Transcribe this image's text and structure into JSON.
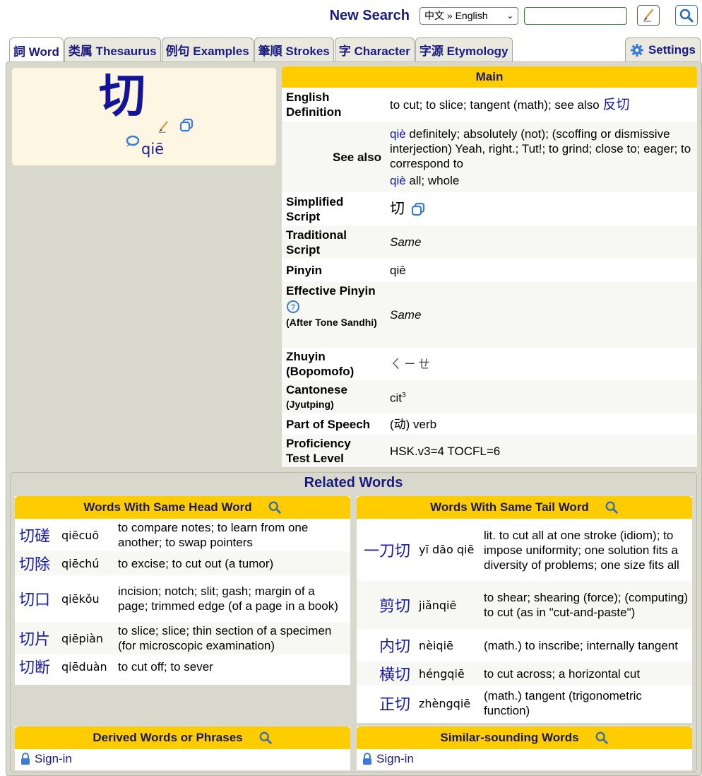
{
  "header": {
    "new_search_label": "New Search",
    "language_select": "中文 » English",
    "search_input_value": "",
    "handwriting_icon": "brush-icon",
    "search_icon": "search-icon"
  },
  "tabs": [
    {
      "label": "詞 Word",
      "active": true
    },
    {
      "label": "类属 Thesaurus"
    },
    {
      "label": "例句 Examples"
    },
    {
      "label": "筆順 Strokes"
    },
    {
      "label": "字 Character"
    },
    {
      "label": "字源 Etymology"
    }
  ],
  "settings_tab": {
    "label": "Settings",
    "icon": "gear-icon"
  },
  "colors": {
    "accent_yellow": "#ffcc00",
    "link_blue": "#1a1aa8",
    "title_navy": "#1a1a80",
    "panel_bg": "#d8d8cd",
    "card_bg": "#fcf6e2"
  },
  "word_card": {
    "character": "切",
    "pinyin": "qiē"
  },
  "main": {
    "title": "Main",
    "english_definition_label": "English Definition",
    "english_definition_text": "to cut; to slice; tangent (math); see also",
    "english_definition_link": "反切",
    "see_also_label": "See also",
    "see_also": [
      {
        "pinyin": "qiè",
        "text": "definitely; absolutely (not); (scoffing or dismissive interjection) Yeah, right.; Tut!; to grind; close to; eager; to correspond to"
      },
      {
        "pinyin": "qiè",
        "text": "all; whole"
      }
    ],
    "simplified_label_1": "Simplified",
    "simplified_label_2": "Script",
    "simplified_value": "切",
    "traditional_label_1": "Traditional",
    "traditional_label_2": "Script",
    "traditional_value": "Same",
    "pinyin_label": "Pinyin",
    "pinyin_value": "qiē",
    "effective_pinyin_label": "Effective Pinyin",
    "effective_pinyin_note": "(After Tone Sandhi)",
    "effective_pinyin_value": "Same",
    "zhuyin_label_1": "Zhuyin",
    "zhuyin_label_2": "(Bopomofo)",
    "zhuyin_value": "ㄑㄧㄝ",
    "cantonese_label": "Cantonese",
    "cantonese_note": "(Jyutping)",
    "cantonese_value": "cit",
    "cantonese_tone": "3",
    "pos_label": "Part of Speech",
    "pos_value": "(动) verb",
    "proficiency_label_1": "Proficiency",
    "proficiency_label_2": "Test Level",
    "proficiency_value": "HSK.v3=4 TOCFL=6"
  },
  "related": {
    "title": "Related Words",
    "head_word": {
      "title": "Words With Same Head Word",
      "rows": [
        {
          "hanzi": "切磋",
          "pinyin": "qiēcuō",
          "def": "to compare notes; to learn from one another; to swap pointers"
        },
        {
          "hanzi": "切除",
          "pinyin": "qiēchú",
          "def": "to excise; to cut out (a tumor)"
        },
        {
          "hanzi": "切口",
          "pinyin": "qiēkǒu",
          "def": "incision; notch; slit; gash; margin of a page; trimmed edge (of a page in a book)"
        },
        {
          "hanzi": "切片",
          "pinyin": "qiēpiàn",
          "def": "to slice; slice; thin section of a specimen (for microscopic examination)"
        },
        {
          "hanzi": "切断",
          "pinyin": "qiēduàn",
          "def": "to cut off; to sever"
        }
      ]
    },
    "tail_word": {
      "title": "Words With Same Tail Word",
      "rows": [
        {
          "hanzi": "一刀切",
          "pinyin": "yī dāo qiē",
          "def": "lit. to cut all at one stroke (idiom); to impose uniformity; one solution fits a diversity of problems; one size fits all"
        },
        {
          "hanzi": "剪切",
          "pinyin": "jiǎnqiē",
          "def": "to shear; shearing (force); (computing) to cut (as in \"cut-and-paste\")"
        },
        {
          "hanzi": "内切",
          "pinyin": "nèiqiē",
          "def": "(math.) to inscribe; internally tangent"
        },
        {
          "hanzi": "横切",
          "pinyin": "héngqiē",
          "def": "to cut across; a horizontal cut"
        },
        {
          "hanzi": "正切",
          "pinyin": "zhèngqiē",
          "def": "(math.) tangent (trigonometric function)"
        }
      ]
    },
    "derived": {
      "title": "Derived Words or Phrases",
      "signin": "Sign-in"
    },
    "similar": {
      "title": "Similar-sounding Words",
      "signin": "Sign-in"
    }
  }
}
